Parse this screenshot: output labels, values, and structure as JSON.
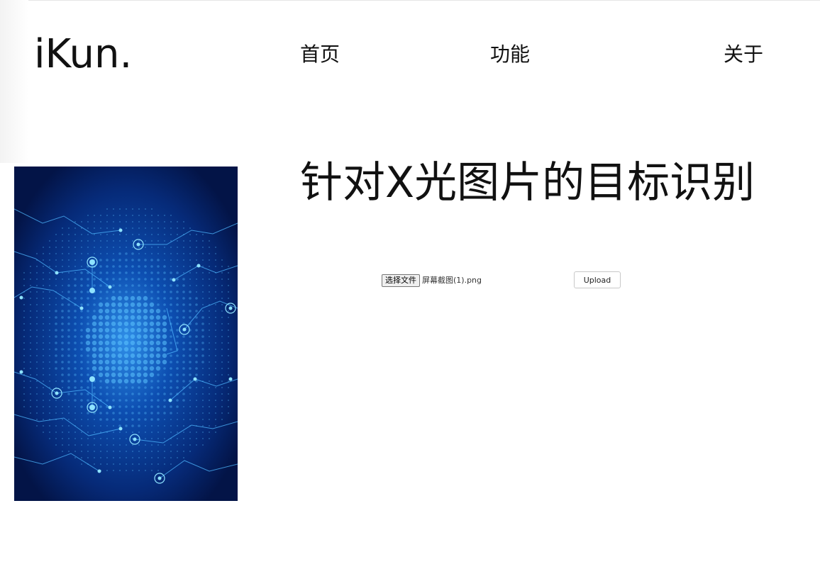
{
  "header": {
    "logo": "iKun.",
    "nav": [
      {
        "label": "首页"
      },
      {
        "label": "功能"
      },
      {
        "label": "关于"
      }
    ]
  },
  "main": {
    "title": "针对X光图片的目标识别",
    "image": {
      "icon": "circuit-network-illustration"
    },
    "upload": {
      "file_button_label": "选择文件",
      "file_name": "屏幕截图(1).png",
      "upload_label": "Upload"
    }
  },
  "colors": {
    "background": "#ffffff",
    "text": "#111111",
    "image_dark": "#04184f",
    "image_glow": "#3aa6ff"
  }
}
